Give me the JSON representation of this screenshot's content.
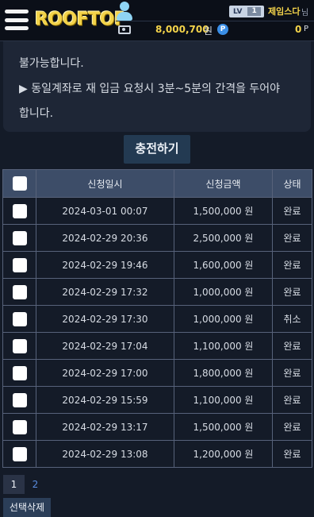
{
  "header": {
    "logo": "ROOFTOP",
    "level_label": "LV",
    "level_value": "1",
    "username": "제임스다",
    "username_suffix": "님",
    "balance": "8,000,700",
    "balance_unit": "원",
    "point_icon_label": "P",
    "points": "0",
    "points_unit": "P"
  },
  "notice": {
    "lines": [
      "불가능합니다.",
      "▶ 동일계좌로 재 입금 요청시 3분~5분의 간격을 두어야",
      "합니다."
    ]
  },
  "charge_button": "충전하기",
  "table": {
    "headers": [
      "신청일시",
      "신청금액",
      "상태"
    ],
    "rows": [
      {
        "date": "2024-03-01 00:07",
        "amount": "1,500,000 원",
        "status": "완료"
      },
      {
        "date": "2024-02-29 20:36",
        "amount": "2,500,000 원",
        "status": "완료"
      },
      {
        "date": "2024-02-29 19:46",
        "amount": "1,600,000 원",
        "status": "완료"
      },
      {
        "date": "2024-02-29 17:32",
        "amount": "1,000,000 원",
        "status": "완료"
      },
      {
        "date": "2024-02-29 17:30",
        "amount": "1,000,000 원",
        "status": "취소"
      },
      {
        "date": "2024-02-29 17:04",
        "amount": "1,100,000 원",
        "status": "완료"
      },
      {
        "date": "2024-02-29 17:00",
        "amount": "1,800,000 원",
        "status": "완료"
      },
      {
        "date": "2024-02-29 15:59",
        "amount": "1,100,000 원",
        "status": "완료"
      },
      {
        "date": "2024-02-29 13:17",
        "amount": "1,500,000 원",
        "status": "완료"
      },
      {
        "date": "2024-02-29 13:08",
        "amount": "1,200,000 원",
        "status": "완료"
      }
    ]
  },
  "pagination": [
    "1",
    "2"
  ],
  "delete_button": "선택삭제",
  "colors": {
    "background": "#141b28",
    "accent_yellow": "#f3d34a",
    "header_row": "#3d4d68",
    "button": "#233a52"
  },
  "icons": [
    "menu-icon",
    "user-icon",
    "money-icon",
    "point-icon"
  ]
}
